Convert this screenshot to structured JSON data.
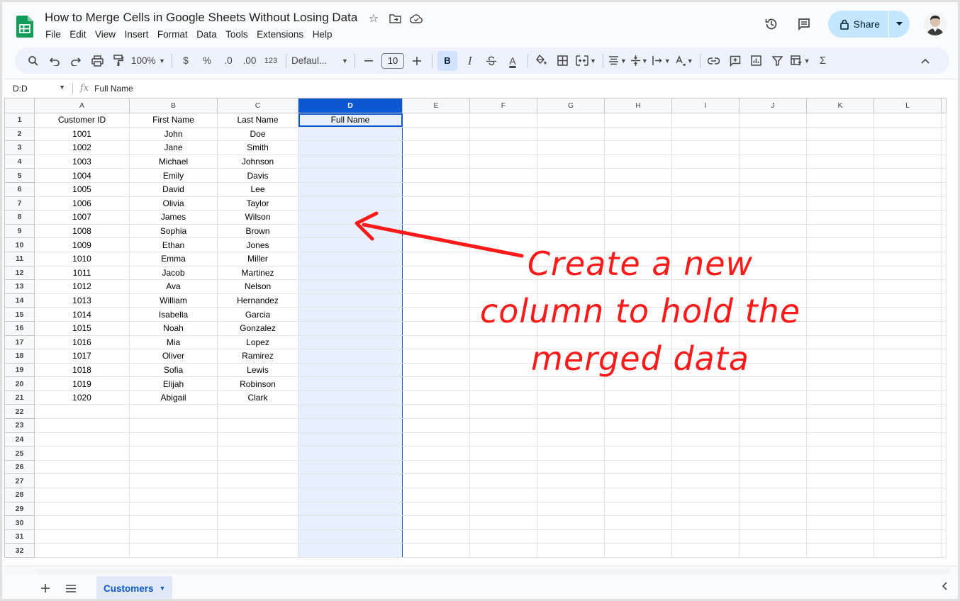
{
  "doc": {
    "title": "How to Merge Cells in Google Sheets Without Losing Data"
  },
  "menu": [
    "File",
    "Edit",
    "View",
    "Insert",
    "Format",
    "Data",
    "Tools",
    "Extensions",
    "Help"
  ],
  "header": {
    "share_label": "Share"
  },
  "toolbar": {
    "zoom": "100%",
    "currency": "$",
    "percent": "%",
    "dec_decrease": ".0",
    "dec_increase": ".00",
    "number_format": "123",
    "font": "Defaul...",
    "font_size": "10",
    "bold": "B",
    "italic": "I",
    "text_color": "A",
    "sum": "Σ"
  },
  "formula_bar": {
    "name_box": "D:D",
    "fx": "fx",
    "value": "Full Name"
  },
  "columns": [
    "A",
    "B",
    "C",
    "D",
    "E",
    "F",
    "G",
    "H",
    "I",
    "J",
    "K",
    "L"
  ],
  "selected_column": "D",
  "table": {
    "headers": [
      "Customer ID",
      "First Name",
      "Last Name",
      "Full Name"
    ],
    "rows": [
      [
        "1001",
        "John",
        "Doe"
      ],
      [
        "1002",
        "Jane",
        "Smith"
      ],
      [
        "1003",
        "Michael",
        "Johnson"
      ],
      [
        "1004",
        "Emily",
        "Davis"
      ],
      [
        "1005",
        "David",
        "Lee"
      ],
      [
        "1006",
        "Olivia",
        "Taylor"
      ],
      [
        "1007",
        "James",
        "Wilson"
      ],
      [
        "1008",
        "Sophia",
        "Brown"
      ],
      [
        "1009",
        "Ethan",
        "Jones"
      ],
      [
        "1010",
        "Emma",
        "Miller"
      ],
      [
        "1011",
        "Jacob",
        "Martinez"
      ],
      [
        "1012",
        "Ava",
        "Nelson"
      ],
      [
        "1013",
        "William",
        "Hernandez"
      ],
      [
        "1014",
        "Isabella",
        "Garcia"
      ],
      [
        "1015",
        "Noah",
        "Gonzalez"
      ],
      [
        "1016",
        "Mia",
        "Lopez"
      ],
      [
        "1017",
        "Oliver",
        "Ramirez"
      ],
      [
        "1018",
        "Sofia",
        "Lewis"
      ],
      [
        "1019",
        "Elijah",
        "Robinson"
      ],
      [
        "1020",
        "Abigail",
        "Clark"
      ]
    ]
  },
  "total_rows": 32,
  "sheet_tabs": [
    "Customers"
  ],
  "annotation": {
    "line1": "Create a new",
    "line2": "column to hold the",
    "line3": "merged data",
    "color": "#ff1a1a"
  },
  "colors": {
    "accent": "#0b57d0",
    "share_bg": "#c2e7ff",
    "toolbar_bg": "#edf2fa",
    "selection_bg": "#e8f0fe",
    "sheets_green": "#0f9d58"
  }
}
